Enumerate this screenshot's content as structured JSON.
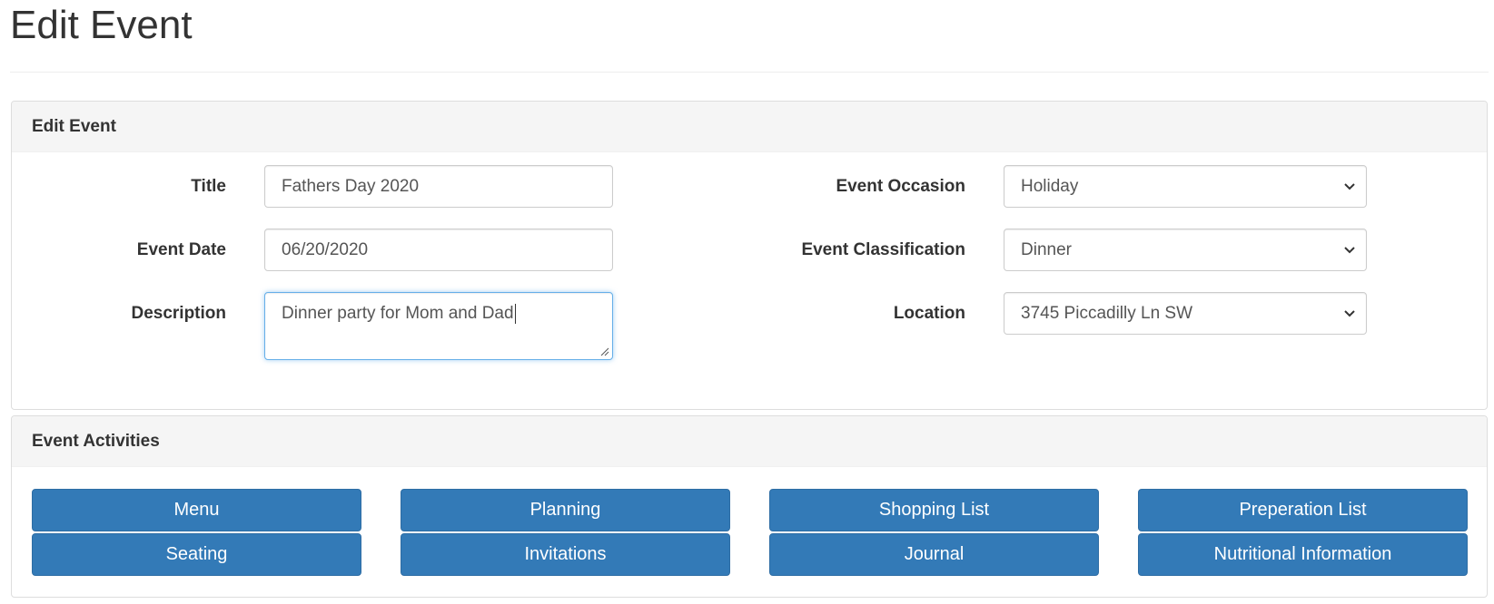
{
  "page": {
    "title": "Edit Event"
  },
  "edit_panel": {
    "heading": "Edit Event",
    "fields": {
      "title": {
        "label": "Title",
        "value": "Fathers Day 2020"
      },
      "event_date": {
        "label": "Event Date",
        "value": "06/20/2020"
      },
      "description": {
        "label": "Description",
        "value": "Dinner party for Mom and Dad"
      },
      "event_occasion": {
        "label": "Event Occasion",
        "value": "Holiday"
      },
      "event_classification": {
        "label": "Event Classification",
        "value": "Dinner"
      },
      "location": {
        "label": "Location",
        "value": "3745 Piccadilly Ln SW"
      }
    }
  },
  "activities_panel": {
    "heading": "Event Activities",
    "buttons": [
      {
        "label": "Menu"
      },
      {
        "label": "Planning"
      },
      {
        "label": "Shopping List"
      },
      {
        "label": "Preperation List"
      },
      {
        "label": "Seating"
      },
      {
        "label": "Invitations"
      },
      {
        "label": "Journal"
      },
      {
        "label": "Nutritional Information"
      }
    ]
  },
  "colors": {
    "primary_button": "#337ab7",
    "panel_heading_bg": "#f5f5f5",
    "focus_border": "#66afe9",
    "text": "#333333"
  },
  "icons": {
    "select": "chevron-down-icon",
    "textarea": "resize-handle-icon"
  }
}
